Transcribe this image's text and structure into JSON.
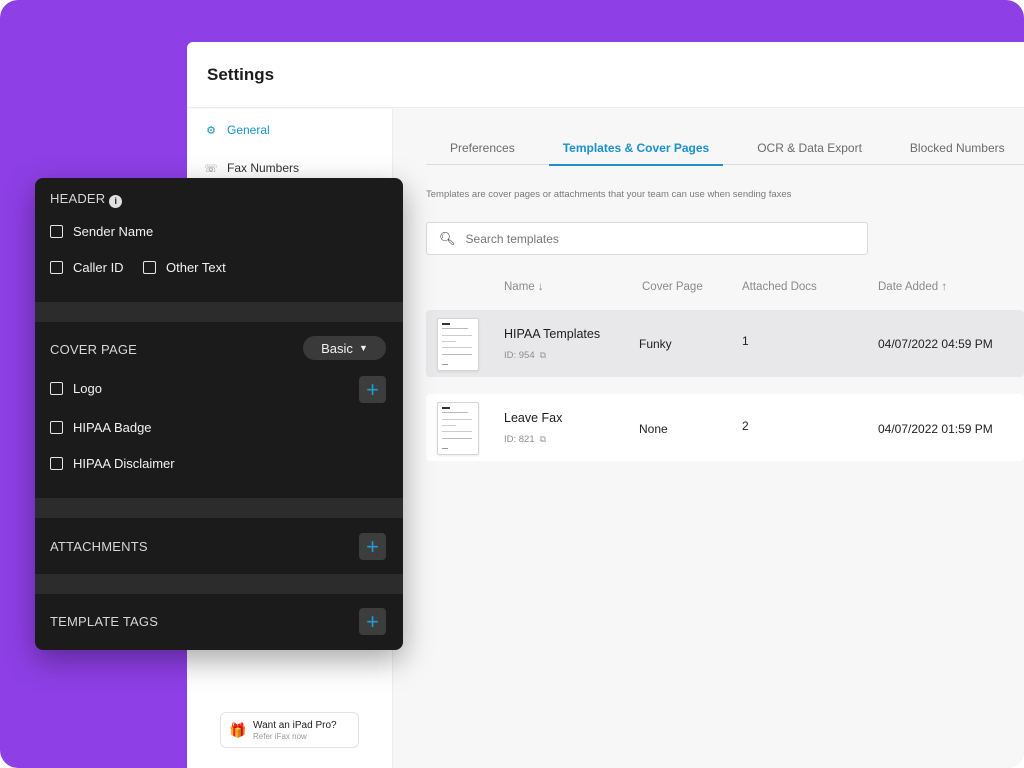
{
  "app": {
    "title": "Settings"
  },
  "sidebar": {
    "items": [
      {
        "label": "General",
        "icon": "gear-icon",
        "active": true
      },
      {
        "label": "Fax Numbers",
        "icon": "fax-icon",
        "active": false
      }
    ],
    "promo": {
      "title": "Want an iPad Pro?",
      "subtitle": "Refer iFax now",
      "icon": "gift-icon"
    }
  },
  "tabs": [
    {
      "label": "Preferences",
      "active": false
    },
    {
      "label": "Templates & Cover Pages",
      "active": true
    },
    {
      "label": "OCR & Data Export",
      "active": false
    },
    {
      "label": "Blocked Numbers",
      "active": false
    }
  ],
  "intro_text": "Templates are cover pages or attachments that your team can use when sending faxes",
  "search": {
    "placeholder": "Search templates"
  },
  "table": {
    "columns": {
      "name": "Name",
      "cover_page": "Cover Page",
      "attached_docs": "Attached Docs",
      "date_added": "Date Added"
    },
    "rows": [
      {
        "name": "HIPAA Templates",
        "id": "ID: 954",
        "cover_page": "Funky",
        "attached_docs": "1",
        "date_added": "04/07/2022 04:59 PM"
      },
      {
        "name": "Leave Fax",
        "id": "ID: 821",
        "cover_page": "None",
        "attached_docs": "2",
        "date_added": "04/07/2022 01:59 PM"
      }
    ]
  },
  "panel": {
    "header": {
      "title": "HEADER",
      "options": [
        "Sender Name",
        "Caller ID",
        "Other Text"
      ]
    },
    "cover_page": {
      "title": "COVER PAGE",
      "dropdown_value": "Basic",
      "options": [
        "Logo",
        "HIPAA Badge",
        "HIPAA Disclaimer"
      ]
    },
    "attachments": {
      "title": "ATTACHMENTS"
    },
    "template_tags": {
      "title": "TEMPLATE TAGS"
    }
  },
  "colors": {
    "background": "#8e3fe6",
    "accent": "#1a91c9",
    "panel": "#1b1b1b"
  }
}
